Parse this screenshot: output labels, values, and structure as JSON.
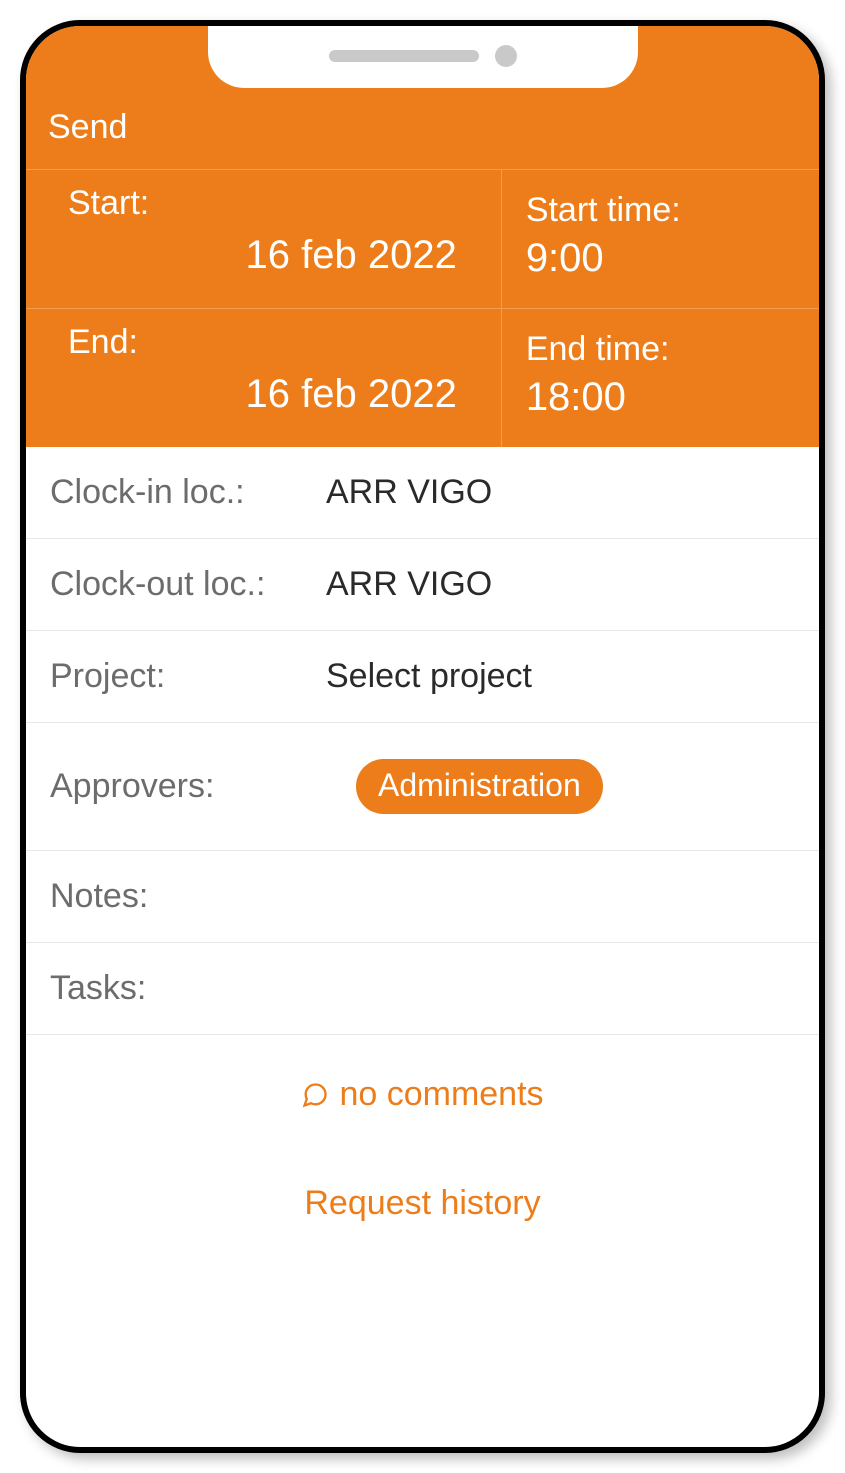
{
  "header": {
    "send_label": "Send",
    "start": {
      "label": "Start:",
      "date": "16 feb 2022",
      "time_label": "Start time:",
      "time": "9:00"
    },
    "end": {
      "label": "End:",
      "date": "16 feb 2022",
      "time_label": "End time:",
      "time": "18:00"
    }
  },
  "form": {
    "clock_in_label": "Clock-in loc.:",
    "clock_in_value": "ARR VIGO",
    "clock_out_label": "Clock-out loc.:",
    "clock_out_value": "ARR VIGO",
    "project_label": "Project:",
    "project_value": "Select project",
    "approvers_label": "Approvers:",
    "approvers_chip": "Administration",
    "notes_label": "Notes:",
    "tasks_label": "Tasks:"
  },
  "actions": {
    "comments": "no comments",
    "history": "Request history"
  }
}
